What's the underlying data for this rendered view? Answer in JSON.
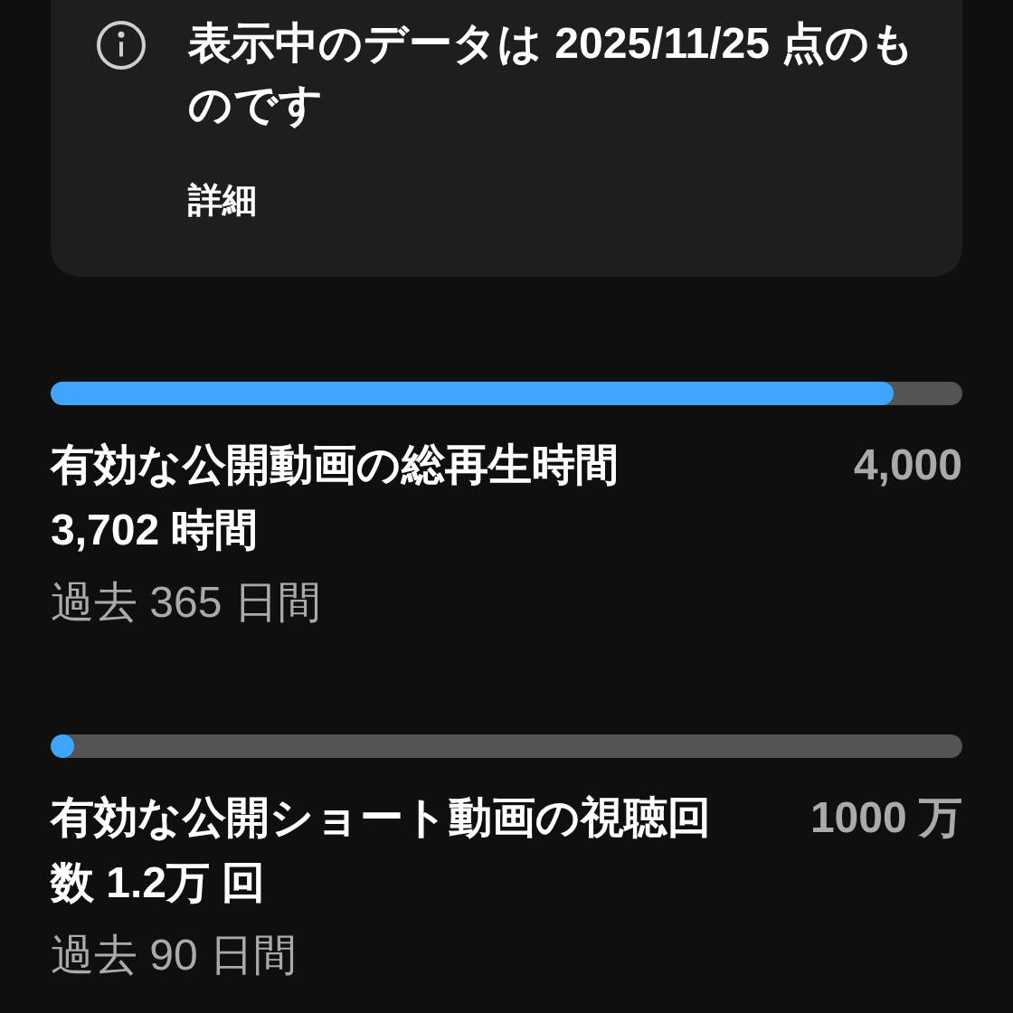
{
  "notice": {
    "text": "表示中のデータは 2025/11/25 点のものです",
    "link": "詳細"
  },
  "metrics": [
    {
      "level": 0.925,
      "label": "有効な公開動画の総再生時間 3,702 時間",
      "target": "4,000",
      "period": "過去 365 日間"
    },
    {
      "level": 0.015,
      "label": "有効な公開ショート動画の視聴回数 1.2万 回",
      "target": "1000 万",
      "period": "過去 90 日間"
    }
  ]
}
